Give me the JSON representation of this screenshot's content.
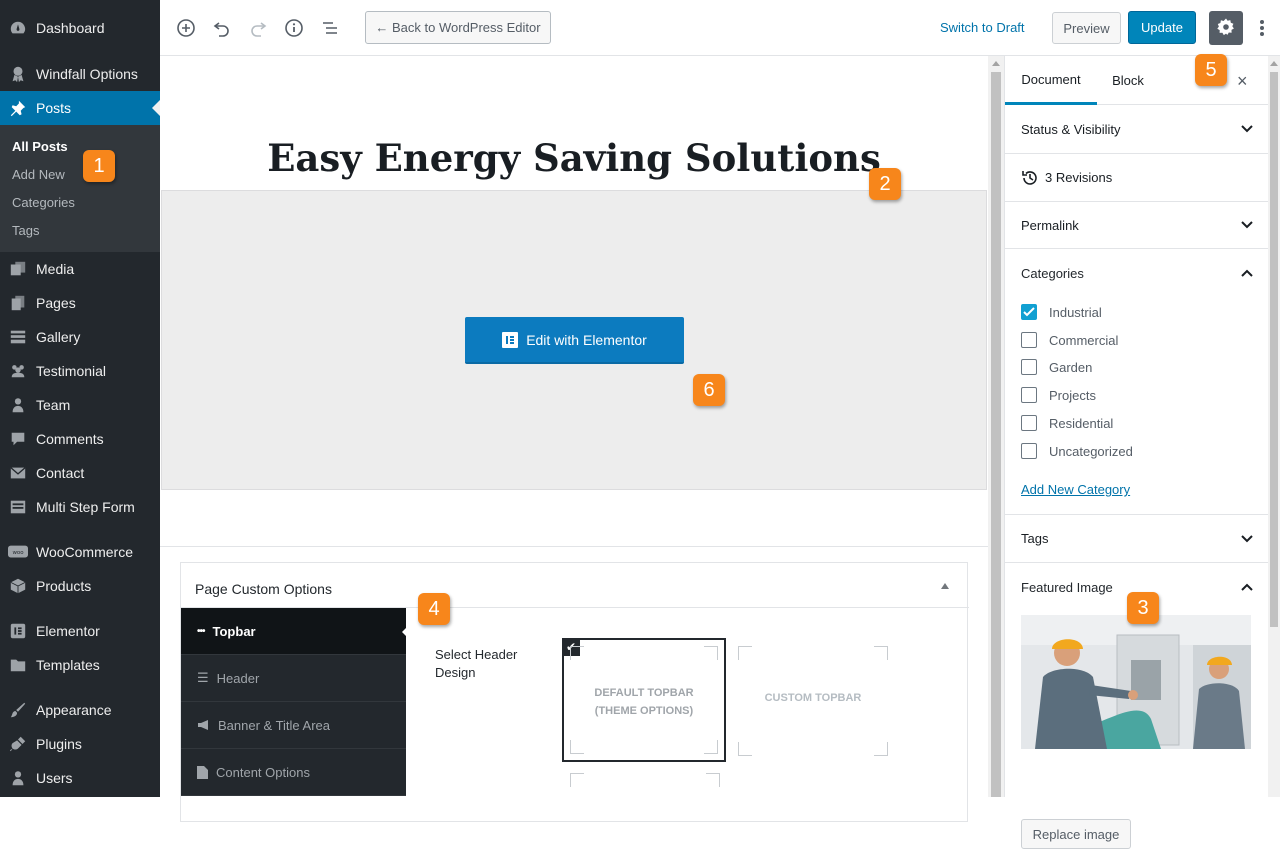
{
  "sidebar": {
    "items": [
      {
        "label": "Dashboard",
        "icon": "dashboard-icon"
      },
      {
        "label": "Windfall Options",
        "icon": "award-icon"
      },
      {
        "label": "Posts",
        "icon": "pin-icon"
      },
      {
        "label": "Media",
        "icon": "media-icon"
      },
      {
        "label": "Pages",
        "icon": "pages-icon"
      },
      {
        "label": "Gallery",
        "icon": "gallery-icon"
      },
      {
        "label": "Testimonial",
        "icon": "groups-icon"
      },
      {
        "label": "Team",
        "icon": "person-icon"
      },
      {
        "label": "Comments",
        "icon": "comment-icon"
      },
      {
        "label": "Contact",
        "icon": "mail-icon"
      },
      {
        "label": "Multi Step Form",
        "icon": "form-icon"
      },
      {
        "label": "WooCommerce",
        "icon": "woo-icon"
      },
      {
        "label": "Products",
        "icon": "box-icon"
      },
      {
        "label": "Elementor",
        "icon": "elementor-icon"
      },
      {
        "label": "Templates",
        "icon": "folder-icon"
      },
      {
        "label": "Appearance",
        "icon": "brush-icon"
      },
      {
        "label": "Plugins",
        "icon": "plug-icon"
      },
      {
        "label": "Users",
        "icon": "user-icon"
      }
    ],
    "submenu": [
      "All Posts",
      "Add New",
      "Categories",
      "Tags"
    ]
  },
  "toolbar": {
    "back_label": "← Back to WordPress Editor",
    "switch_draft": "Switch to Draft",
    "preview": "Preview",
    "update": "Update"
  },
  "editor": {
    "title": "Easy Energy Saving Solutions",
    "elementor_button": "Edit with Elementor"
  },
  "custom_options": {
    "title": "Page Custom Options",
    "nav": [
      "Topbar",
      "Header",
      "Banner & Title Area",
      "Content Options"
    ],
    "field_label": "Select Header Design",
    "option_default_line1": "DEFAULT TOPBAR",
    "option_default_line2": "(THEME OPTIONS)",
    "option_custom": "CUSTOM TOPBAR"
  },
  "panel": {
    "tab_document": "Document",
    "tab_block": "Block",
    "status_visibility": "Status & Visibility",
    "revisions": "3 Revisions",
    "permalink": "Permalink",
    "categories_title": "Categories",
    "categories": [
      {
        "label": "Industrial",
        "checked": true
      },
      {
        "label": "Commercial",
        "checked": false
      },
      {
        "label": "Garden",
        "checked": false
      },
      {
        "label": "Projects",
        "checked": false
      },
      {
        "label": "Residential",
        "checked": false
      },
      {
        "label": "Uncategorized",
        "checked": false
      }
    ],
    "add_category": "Add New Category",
    "tags": "Tags",
    "featured_image": "Featured Image",
    "replace_image": "Replace image"
  },
  "badges": [
    "1",
    "2",
    "3",
    "4",
    "5",
    "6"
  ],
  "colors": {
    "accent": "#0073aa",
    "badge": "#f7861b",
    "sidebar": "#23282d"
  }
}
